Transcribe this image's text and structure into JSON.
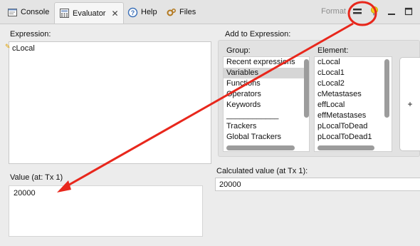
{
  "tabs": [
    {
      "label": "Console",
      "icon": "console-icon"
    },
    {
      "label": "Evaluator",
      "icon": "calculator-icon",
      "active": true
    },
    {
      "label": "Help",
      "icon": "help-icon"
    },
    {
      "label": "Files",
      "icon": "gear-icon"
    }
  ],
  "toolbar": {
    "format_label": "Format",
    "equals_icon": "equals-icon",
    "lightbulb_icon": "lightbulb-icon"
  },
  "expression": {
    "label": "Expression:",
    "value": "cLocal"
  },
  "add_to_expression": {
    "label": "Add to Expression:",
    "group_label": "Group:",
    "element_label": "Element:",
    "groups": [
      "Recent expressions",
      "Variables",
      "Functions",
      "Operators",
      "Keywords",
      "____________",
      "Trackers",
      "Global Trackers"
    ],
    "selected_group": "Variables",
    "elements": [
      "cLocal",
      "cLocal1",
      "cLocal2",
      "cMetastases",
      "effLocal",
      "effMetastases",
      "pLocalToDead",
      "pLocalToDead1"
    ],
    "add_button": "+"
  },
  "value": {
    "label": "Value (at: Tx 1)",
    "value": "20000"
  },
  "calculated": {
    "label": "Calculated value (at Tx 1):",
    "value": "20000"
  },
  "colors": {
    "annotation": "#e8271c",
    "selection": "#d6d6d6"
  }
}
